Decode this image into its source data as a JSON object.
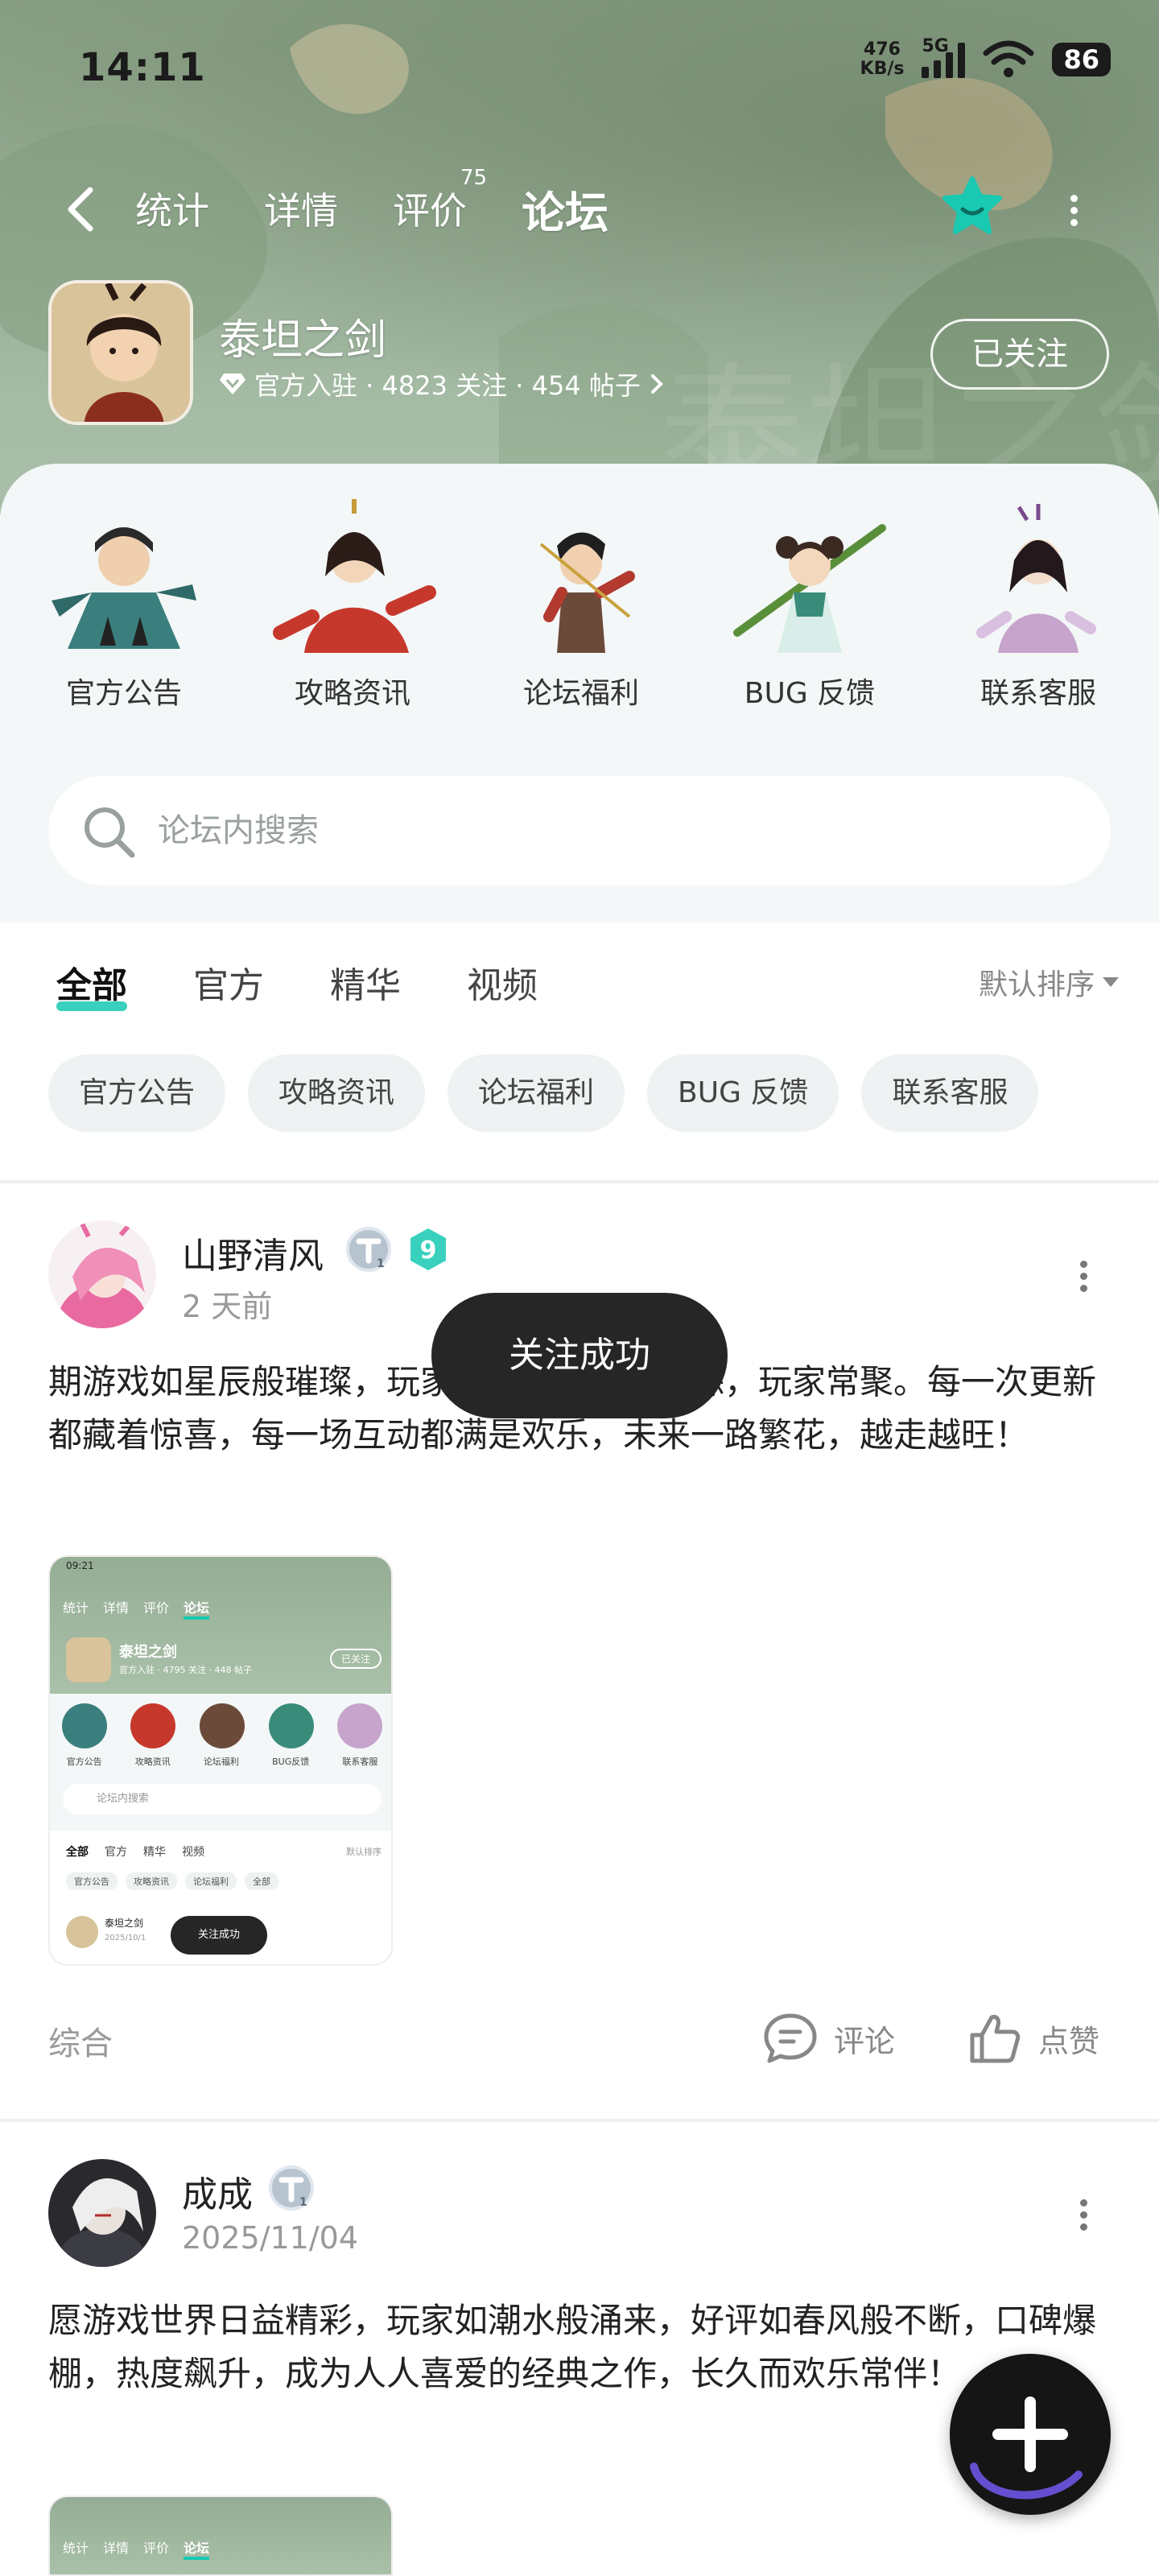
{
  "status_bar": {
    "time": "14:11",
    "net_speed_value": "476",
    "net_speed_unit": "KB/s",
    "network": "5G",
    "battery": "86"
  },
  "nav": {
    "tabs": [
      {
        "label": "统计"
      },
      {
        "label": "详情"
      },
      {
        "label": "评价",
        "badge": "75"
      },
      {
        "label": "论坛"
      }
    ],
    "active_tab": "论坛"
  },
  "forum": {
    "name": "泰坦之剑",
    "meta": "官方入驻 · 4823 关注 · 454 帖子",
    "follow_label": "已关注"
  },
  "categories": [
    {
      "label": "官方公告"
    },
    {
      "label": "攻略资讯"
    },
    {
      "label": "论坛福利"
    },
    {
      "label": "BUG 反馈"
    },
    {
      "label": "联系客服"
    }
  ],
  "search": {
    "placeholder": "论坛内搜索"
  },
  "filter_tabs": [
    {
      "label": "全部"
    },
    {
      "label": "官方"
    },
    {
      "label": "精华"
    },
    {
      "label": "视频"
    }
  ],
  "active_filter": "全部",
  "sort_label": "默认排序",
  "chips": [
    {
      "label": "官方公告"
    },
    {
      "label": "攻略资讯"
    },
    {
      "label": "论坛福利"
    },
    {
      "label": "BUG 反馈"
    },
    {
      "label": "联系客服"
    }
  ],
  "posts": [
    {
      "author": "山野清风",
      "time": "2 天前",
      "level": "9",
      "text": "期游戏如星辰般璀璨，玩家影随心，每日追踪，玩家常聚。每一次更新都藏着惊喜，每一场互动都满是欢乐，未来一路繁花，越走越旺！",
      "type": "综合",
      "comment_label": "评论",
      "like_label": "点赞"
    },
    {
      "author": "成成",
      "time": "2025/11/04",
      "text": "愿游戏世界日益精彩，玩家如潮水般涌来，好评如春风般不断，口碑爆棚，热度飙升，成为人人喜爱的经典之作，长久而欢乐常伴！"
    }
  ],
  "thumbnail": {
    "status_time": "09:21",
    "tabs": [
      "统计",
      "详情",
      "评价",
      "论坛"
    ],
    "forum_name": "泰坦之剑",
    "forum_meta": "官方入驻 · 4795 关注 · 448 帖子",
    "follow_label": "已关注",
    "categories": [
      "官方公告",
      "攻略资讯",
      "论坛福利",
      "BUG反馈",
      "联系客服"
    ],
    "search_placeholder": "论坛内搜索",
    "filter_tabs": [
      "全部",
      "官方",
      "精华",
      "视频"
    ],
    "sort_label": "默认排序",
    "chips": [
      "官方公告",
      "攻略资讯",
      "论坛福利",
      "全部"
    ],
    "post_author": "泰坦之剑",
    "post_date": "2025/10/1",
    "toast": "关注成功"
  },
  "toast": "关注成功",
  "colors": {
    "accent": "#16c9b1",
    "header_bg": "#9db49d",
    "panel_bg": "#f3f7f7",
    "fab": "#151515"
  }
}
